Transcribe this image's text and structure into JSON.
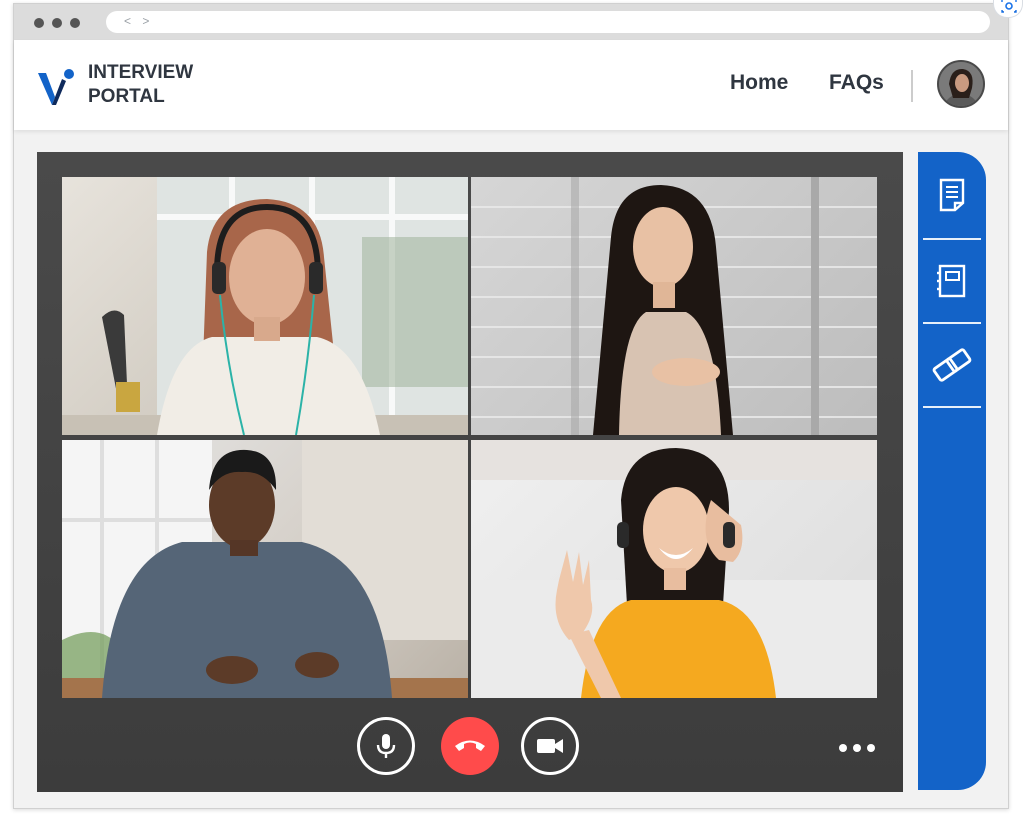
{
  "browser": {
    "address_arrows": "< >"
  },
  "header": {
    "brand_line1": "INTERVIEW",
    "brand_line2": "PORTAL",
    "nav": [
      {
        "label": "Home"
      },
      {
        "label": "FAQs"
      }
    ]
  },
  "colors": {
    "accent_blue": "#1363c8",
    "end_call_red": "#ff4b4b",
    "frame_dark": "#434343"
  },
  "icons": {
    "logo": "v-logo-icon",
    "sidebar": [
      "document-icon",
      "notebook-icon",
      "link-icon"
    ],
    "controls": [
      "microphone-icon",
      "end-call-icon",
      "video-camera-icon",
      "more-options-icon"
    ]
  }
}
